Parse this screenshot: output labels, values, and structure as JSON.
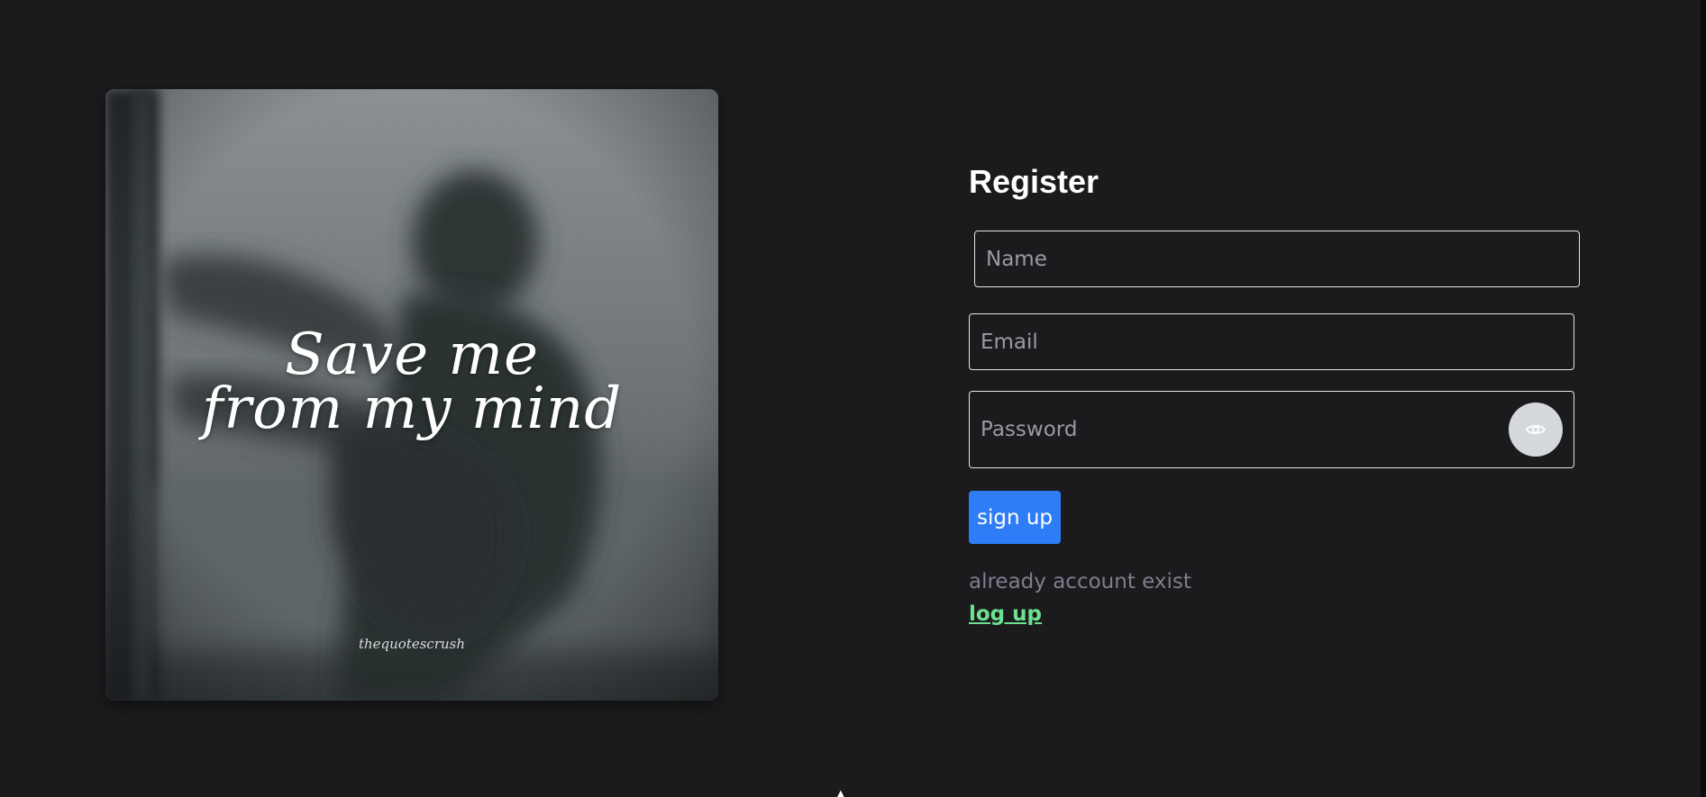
{
  "hero_image": {
    "quote_line_1": "Save me",
    "quote_line_2": "from my mind",
    "watermark": "thequotescrush"
  },
  "register_form": {
    "title": "Register",
    "name_placeholder": "Name",
    "email_placeholder": "Email",
    "password_placeholder": "Password",
    "toggle_password_icon": "eye-icon",
    "signup_label": "sign up",
    "login_hint": "already account exist",
    "login_link": "log up"
  },
  "colors": {
    "background": "#1b1b1e",
    "primary_button": "#2e7df6",
    "link": "#6ee08e",
    "muted_text": "#7c7f8c",
    "field_border": "#e6e6e6"
  }
}
